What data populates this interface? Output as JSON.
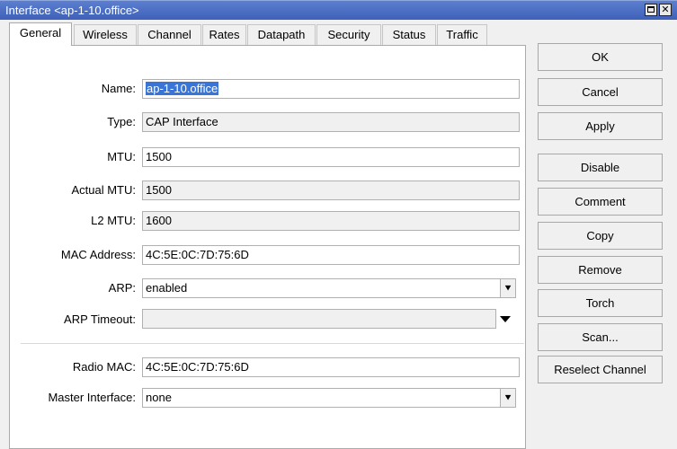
{
  "window": {
    "title": "Interface <ap-1-10.office>"
  },
  "tabs": [
    {
      "label": "General",
      "active": true
    },
    {
      "label": "Wireless"
    },
    {
      "label": "Channel"
    },
    {
      "label": "Rates"
    },
    {
      "label": "Datapath"
    },
    {
      "label": "Security"
    },
    {
      "label": "Status"
    },
    {
      "label": "Traffic"
    }
  ],
  "fields": {
    "name": {
      "label": "Name:",
      "value": "ap-1-10.office"
    },
    "type": {
      "label": "Type:",
      "value": "CAP Interface"
    },
    "mtu": {
      "label": "MTU:",
      "value": "1500"
    },
    "actual_mtu": {
      "label": "Actual MTU:",
      "value": "1500"
    },
    "l2_mtu": {
      "label": "L2 MTU:",
      "value": "1600"
    },
    "mac_address": {
      "label": "MAC Address:",
      "value": "4C:5E:0C:7D:75:6D"
    },
    "arp": {
      "label": "ARP:",
      "value": "enabled"
    },
    "arp_timeout": {
      "label": "ARP Timeout:",
      "value": ""
    },
    "radio_mac": {
      "label": "Radio MAC:",
      "value": "4C:5E:0C:7D:75:6D"
    },
    "master_interface": {
      "label": "Master Interface:",
      "value": "none"
    }
  },
  "buttons": {
    "ok": "OK",
    "cancel": "Cancel",
    "apply": "Apply",
    "disable": "Disable",
    "comment": "Comment",
    "copy": "Copy",
    "remove": "Remove",
    "torch": "Torch",
    "scan": "Scan...",
    "reselect_channel": "Reselect Channel"
  },
  "icons": {
    "window_restore": "restore-icon",
    "window_close": "close-icon",
    "dropdown": "dropdown-arrow-icon",
    "expand": "expand-arrow-icon"
  },
  "colors": {
    "titlebar": "#4a6cc4",
    "selection": "#3875d7"
  }
}
